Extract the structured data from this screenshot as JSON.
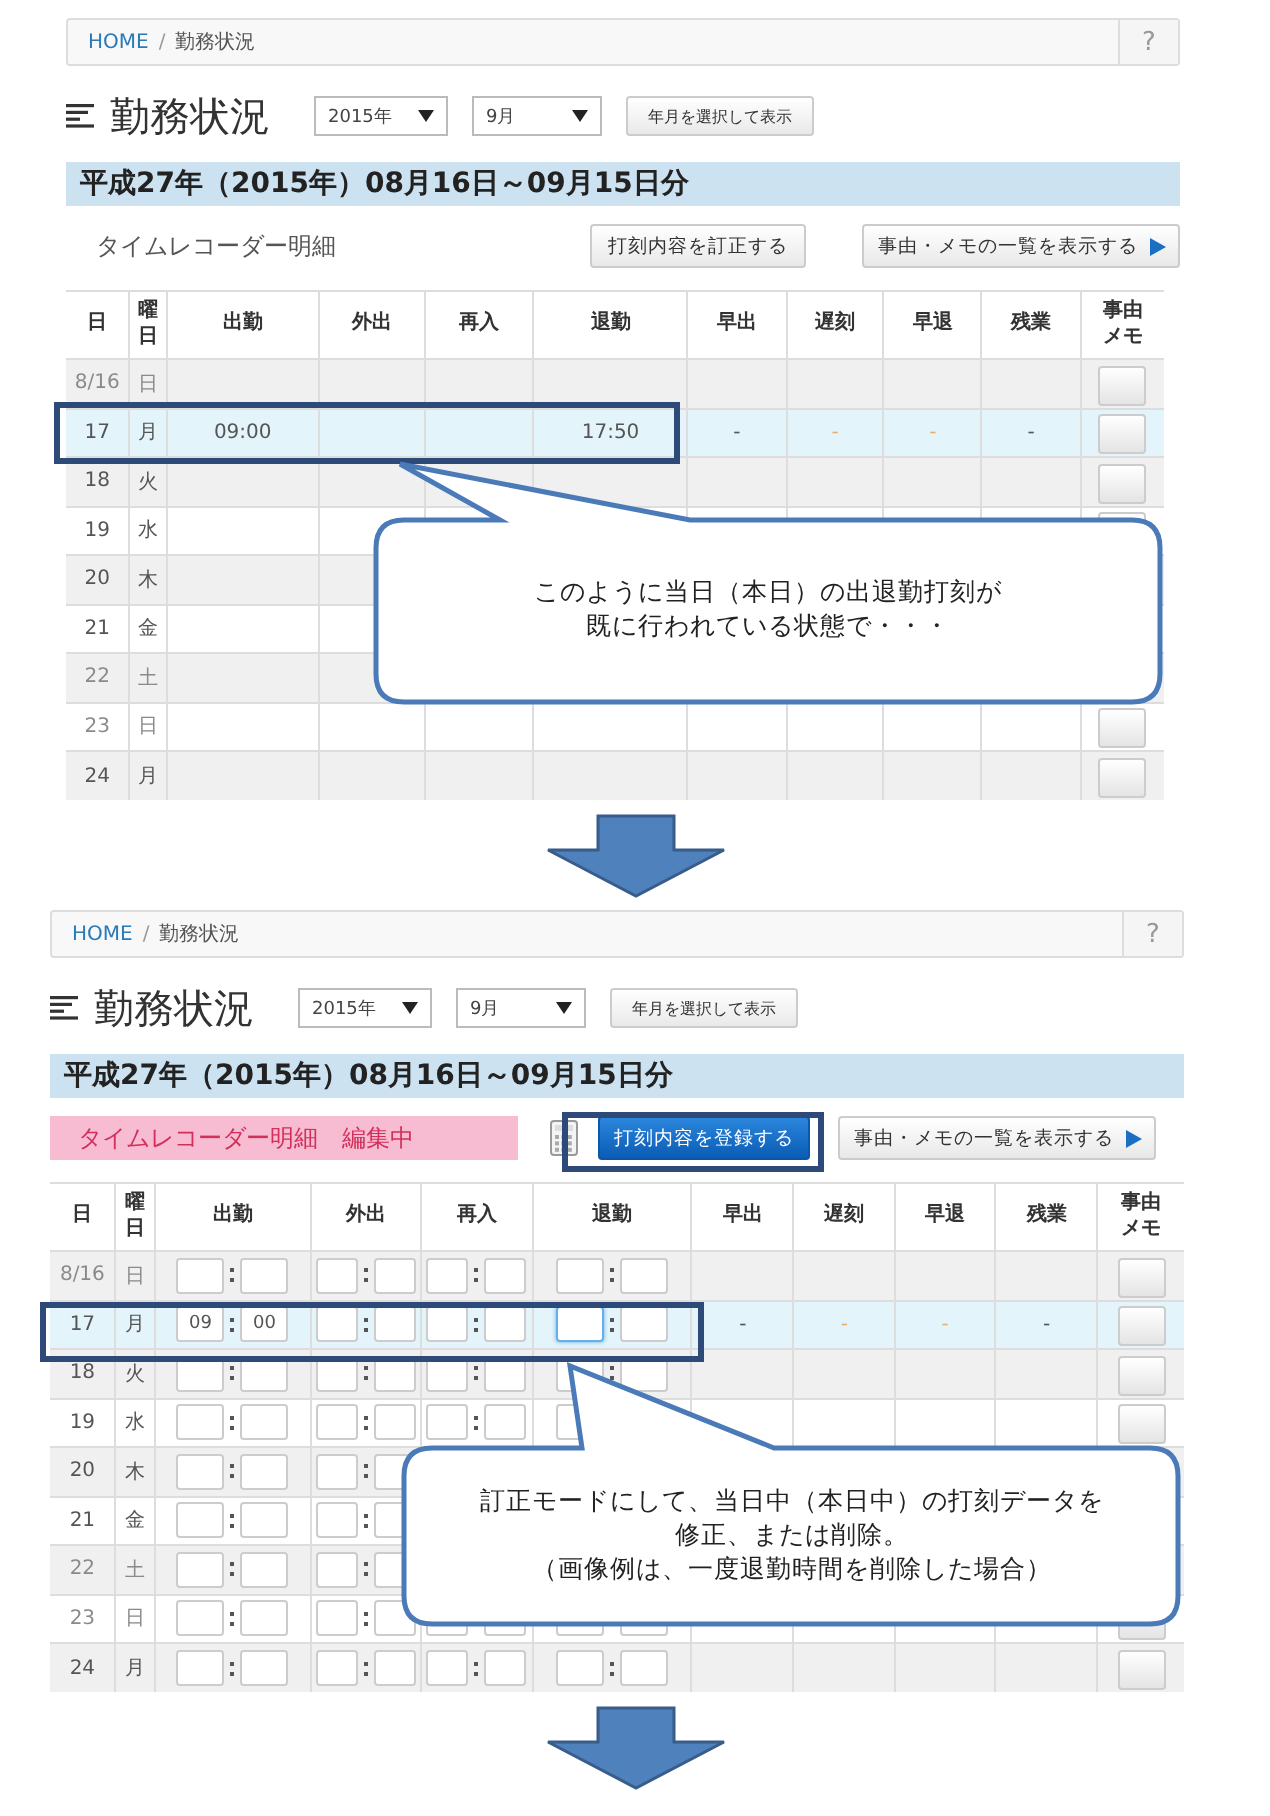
{
  "panels": [
    {
      "editing": false,
      "breadcrumb": {
        "home": "HOME",
        "separator": "/",
        "current": "勤務状況"
      },
      "help": "?",
      "title": "勤務状況",
      "year": "2015年",
      "month": "9月",
      "show_button": "年月を選択して表示",
      "period": "平成27年（2015年）08月16日～09月15日分",
      "section_label": "タイムレコーダー明細",
      "action_button": "打刻内容を訂正する",
      "list_button": "事由・メモの一覧を表示する",
      "columns": [
        "日",
        "曜日",
        "出勤",
        "外出",
        "再入",
        "退勤",
        "早出",
        "遅刻",
        "早退",
        "残業",
        "事由メモ"
      ],
      "rows": [
        {
          "day": "8/16",
          "weekday": "日",
          "dimmed": true,
          "selected": false
        },
        {
          "day": "17",
          "weekday": "月",
          "dimmed": false,
          "selected": true,
          "clock_in": "09:00",
          "clock_out": "17:50",
          "early_start": "-",
          "late": "-",
          "early_leave": "-",
          "overtime": "-"
        },
        {
          "day": "18",
          "weekday": "火",
          "dimmed": false,
          "selected": false
        },
        {
          "day": "19",
          "weekday": "水",
          "dimmed": false,
          "selected": false
        },
        {
          "day": "20",
          "weekday": "木",
          "dimmed": false,
          "selected": false
        },
        {
          "day": "21",
          "weekday": "金",
          "dimmed": false,
          "selected": false
        },
        {
          "day": "22",
          "weekday": "土",
          "dimmed": true,
          "selected": false
        },
        {
          "day": "23",
          "weekday": "日",
          "dimmed": true,
          "selected": false
        },
        {
          "day": "24",
          "weekday": "月",
          "dimmed": false,
          "selected": false
        }
      ],
      "callout": [
        "このように当日（本日）の出退勤打刻が",
        "既に行われている状態で・・・"
      ]
    },
    {
      "editing": true,
      "breadcrumb": {
        "home": "HOME",
        "separator": "/",
        "current": "勤務状況"
      },
      "help": "?",
      "title": "勤務状況",
      "year": "2015年",
      "month": "9月",
      "show_button": "年月を選択して表示",
      "period": "平成27年（2015年）08月16日～09月15日分",
      "section_label": "タイムレコーダー明細　編集中",
      "action_button": "打刻内容を登録する",
      "list_button": "事由・メモの一覧を表示する",
      "columns": [
        "日",
        "曜日",
        "出勤",
        "外出",
        "再入",
        "退勤",
        "早出",
        "遅刻",
        "早退",
        "残業",
        "事由メモ"
      ],
      "rows": [
        {
          "day": "8/16",
          "weekday": "日",
          "dimmed": true,
          "selected": false,
          "clock_out_focused": false
        },
        {
          "day": "17",
          "weekday": "月",
          "dimmed": false,
          "selected": true,
          "clock_out_focused": true,
          "clock_in": {
            "hours": "09",
            "minutes": "00"
          },
          "early_start": "-",
          "late": "-",
          "early_leave": "-",
          "overtime": "-"
        },
        {
          "day": "18",
          "weekday": "火",
          "dimmed": false,
          "selected": false,
          "clock_out_focused": false
        },
        {
          "day": "19",
          "weekday": "水",
          "dimmed": false,
          "selected": false,
          "clock_out_focused": false
        },
        {
          "day": "20",
          "weekday": "木",
          "dimmed": false,
          "selected": false
        },
        {
          "day": "21",
          "weekday": "金",
          "dimmed": false,
          "selected": false
        },
        {
          "day": "22",
          "weekday": "土",
          "dimmed": true,
          "selected": false
        },
        {
          "day": "23",
          "weekday": "日",
          "dimmed": true,
          "selected": false,
          "clock_out_focused": false
        },
        {
          "day": "24",
          "weekday": "月",
          "dimmed": false,
          "selected": false,
          "clock_out_focused": false
        }
      ],
      "callout": [
        "訂正モードにして、当日中（本日中）の打刻データを",
        "修正、または削除。",
        "（画像例は、一度退勤時間を削除した場合）"
      ]
    }
  ]
}
